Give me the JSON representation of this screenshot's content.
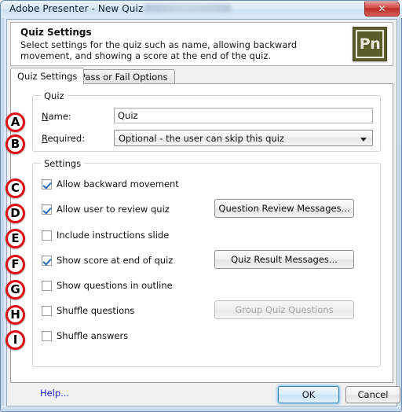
{
  "window": {
    "title": "Adobe Presenter - New Quiz",
    "close_label": "✕"
  },
  "header": {
    "title": "Quiz Settings",
    "description": "Select settings for the quiz such as name, allowing backward movement, and showing a score at the end of the quiz.",
    "logo_text": "Pn"
  },
  "tabs": [
    {
      "label": "Quiz Settings",
      "active": true
    },
    {
      "label": "Pass or Fail Options",
      "active": false
    }
  ],
  "quiz_group": {
    "legend": "Quiz",
    "name_label_accel": "N",
    "name_label_rest": "ame:",
    "name_value": "Quiz",
    "required_label_accel": "R",
    "required_label_rest": "equired:",
    "required_value": "Optional - the user can skip this quiz"
  },
  "settings_group": {
    "legend": "Settings",
    "checkboxes": [
      {
        "label": "Allow backward movement",
        "checked": true
      },
      {
        "label": "Allow user to review quiz",
        "checked": true
      },
      {
        "label": "Include instructions slide",
        "checked": false
      },
      {
        "label": "Show score at end of quiz",
        "checked": true
      },
      {
        "label": "Show questions in outline",
        "checked": false
      },
      {
        "label": "Shuffle questions",
        "checked": false
      },
      {
        "label": "Shuffle answers",
        "checked": false
      }
    ],
    "buttons": {
      "question_review": "Question Review Messages...",
      "quiz_result": "Quiz Result Messages...",
      "group_quiz": "Group Quiz Questions"
    }
  },
  "footer": {
    "help": "Help...",
    "ok": "OK",
    "cancel": "Cancel"
  },
  "annotations": [
    {
      "letter": "A"
    },
    {
      "letter": "B"
    },
    {
      "letter": "C"
    },
    {
      "letter": "D"
    },
    {
      "letter": "E"
    },
    {
      "letter": "F"
    },
    {
      "letter": "G"
    },
    {
      "letter": "H"
    },
    {
      "letter": "I"
    }
  ],
  "colors": {
    "annotation_ring": "#e00a14",
    "help_link": "#2020e0",
    "checkmark": "#2c68b5",
    "logo_bg": "#5b5c2c",
    "close_button": "#c8342d",
    "default_button_glow": "#5aafeb"
  }
}
